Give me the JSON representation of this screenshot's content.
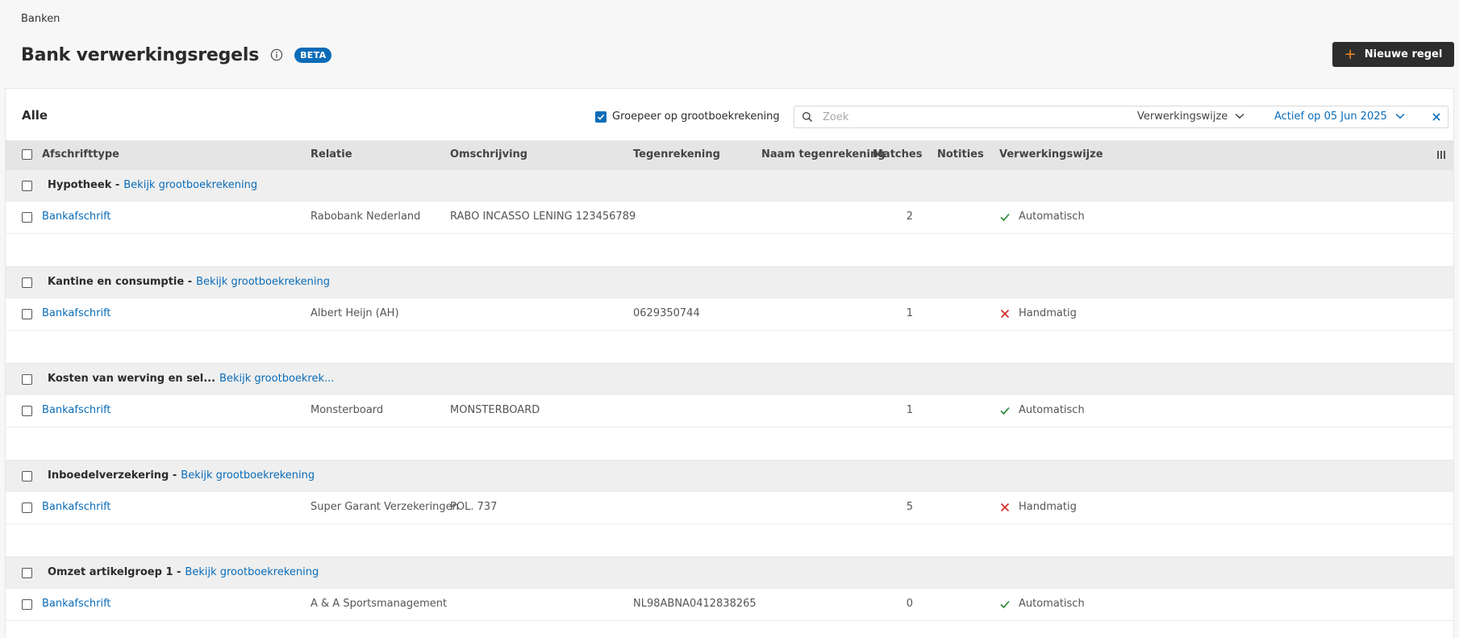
{
  "breadcrumb": "Banken",
  "page": {
    "title": "Bank verwerkingsregels",
    "badge": "BETA"
  },
  "actions": {
    "new_rule_label": "Nieuwe regel"
  },
  "toolbar": {
    "filter_label": "Alle",
    "group_checkbox_label": "Groepeer op grootboekrekening",
    "search_placeholder": "Zoek",
    "mode_dropdown_label": "Verwerkingswijze",
    "date_filter_label": "Actief op 05 Jun 2025"
  },
  "columns": {
    "type": "Afschrifttype",
    "relation": "Relatie",
    "description": "Omschrijving",
    "counter_account": "Tegenrekening",
    "counter_name": "Naam tegenrekening",
    "matches": "Matches",
    "notes": "Notities",
    "mode": "Verwerkingswijze"
  },
  "groups": [
    {
      "name": "Hypotheek -",
      "link": "Bekijk grootboekrekening",
      "row": {
        "type": "Bankafschrift",
        "relation": "Rabobank Nederland",
        "description": "RABO INCASSO LENING 123456789",
        "counter_account": "",
        "matches": "2",
        "mode": "Automatisch",
        "mode_status": "ok"
      }
    },
    {
      "name": "Kantine en consumptie -",
      "link": "Bekijk grootboekrekening",
      "row": {
        "type": "Bankafschrift",
        "relation": "Albert Heijn (AH)",
        "description": "",
        "counter_account": "0629350744",
        "matches": "1",
        "mode": "Handmatig",
        "mode_status": "manual"
      }
    },
    {
      "name": "Kosten van werving en sel...",
      "link": "Bekijk grootboekrek...",
      "row": {
        "type": "Bankafschrift",
        "relation": "Monsterboard",
        "description": "MONSTERBOARD",
        "counter_account": "",
        "matches": "1",
        "mode": "Automatisch",
        "mode_status": "ok"
      }
    },
    {
      "name": "Inboedelverzekering -",
      "link": "Bekijk grootboekrekening",
      "row": {
        "type": "Bankafschrift",
        "relation": "Super Garant Verzekeringen",
        "description": "POL. 737",
        "counter_account": "",
        "matches": "5",
        "mode": "Handmatig",
        "mode_status": "manual"
      }
    },
    {
      "name": "Omzet artikelgroep 1 -",
      "link": "Bekijk grootboekrekening",
      "row": {
        "type": "Bankafschrift",
        "relation": "A & A Sportsmanagement",
        "description": "",
        "counter_account": "NL98ABNA0412838265",
        "matches": "0",
        "mode": "Automatisch",
        "mode_status": "ok"
      }
    }
  ],
  "colors": {
    "accent": "#0a6cb8",
    "ok": "#2e8b3a",
    "manual": "#d42a2a",
    "plus": "#f28a1e"
  }
}
